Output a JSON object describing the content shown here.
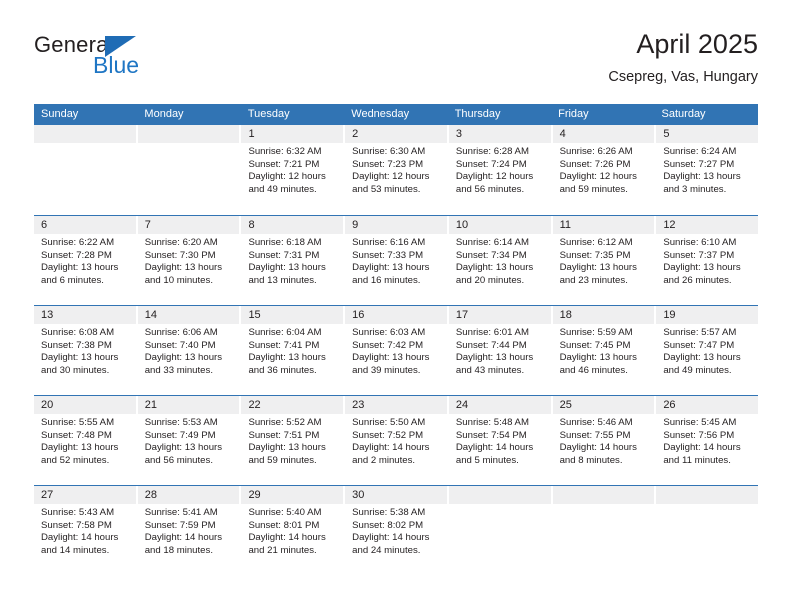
{
  "brand": {
    "name_part1": "General",
    "name_part2": "Blue",
    "accent_color": "#1f76c4",
    "triangle_color": "#1f6cb5"
  },
  "header": {
    "title": "April 2025",
    "subtitle": "Csepreg, Vas, Hungary"
  },
  "calendar": {
    "header_bg": "#3174b4",
    "daynum_bg": "#efeff0",
    "weekdays": [
      "Sunday",
      "Monday",
      "Tuesday",
      "Wednesday",
      "Thursday",
      "Friday",
      "Saturday"
    ],
    "weeks": [
      [
        {
          "day": "",
          "sunrise": "",
          "sunset": "",
          "daylight1": "",
          "daylight2": ""
        },
        {
          "day": "",
          "sunrise": "",
          "sunset": "",
          "daylight1": "",
          "daylight2": ""
        },
        {
          "day": "1",
          "sunrise": "Sunrise: 6:32 AM",
          "sunset": "Sunset: 7:21 PM",
          "daylight1": "Daylight: 12 hours",
          "daylight2": "and 49 minutes."
        },
        {
          "day": "2",
          "sunrise": "Sunrise: 6:30 AM",
          "sunset": "Sunset: 7:23 PM",
          "daylight1": "Daylight: 12 hours",
          "daylight2": "and 53 minutes."
        },
        {
          "day": "3",
          "sunrise": "Sunrise: 6:28 AM",
          "sunset": "Sunset: 7:24 PM",
          "daylight1": "Daylight: 12 hours",
          "daylight2": "and 56 minutes."
        },
        {
          "day": "4",
          "sunrise": "Sunrise: 6:26 AM",
          "sunset": "Sunset: 7:26 PM",
          "daylight1": "Daylight: 12 hours",
          "daylight2": "and 59 minutes."
        },
        {
          "day": "5",
          "sunrise": "Sunrise: 6:24 AM",
          "sunset": "Sunset: 7:27 PM",
          "daylight1": "Daylight: 13 hours",
          "daylight2": "and 3 minutes."
        }
      ],
      [
        {
          "day": "6",
          "sunrise": "Sunrise: 6:22 AM",
          "sunset": "Sunset: 7:28 PM",
          "daylight1": "Daylight: 13 hours",
          "daylight2": "and 6 minutes."
        },
        {
          "day": "7",
          "sunrise": "Sunrise: 6:20 AM",
          "sunset": "Sunset: 7:30 PM",
          "daylight1": "Daylight: 13 hours",
          "daylight2": "and 10 minutes."
        },
        {
          "day": "8",
          "sunrise": "Sunrise: 6:18 AM",
          "sunset": "Sunset: 7:31 PM",
          "daylight1": "Daylight: 13 hours",
          "daylight2": "and 13 minutes."
        },
        {
          "day": "9",
          "sunrise": "Sunrise: 6:16 AM",
          "sunset": "Sunset: 7:33 PM",
          "daylight1": "Daylight: 13 hours",
          "daylight2": "and 16 minutes."
        },
        {
          "day": "10",
          "sunrise": "Sunrise: 6:14 AM",
          "sunset": "Sunset: 7:34 PM",
          "daylight1": "Daylight: 13 hours",
          "daylight2": "and 20 minutes."
        },
        {
          "day": "11",
          "sunrise": "Sunrise: 6:12 AM",
          "sunset": "Sunset: 7:35 PM",
          "daylight1": "Daylight: 13 hours",
          "daylight2": "and 23 minutes."
        },
        {
          "day": "12",
          "sunrise": "Sunrise: 6:10 AM",
          "sunset": "Sunset: 7:37 PM",
          "daylight1": "Daylight: 13 hours",
          "daylight2": "and 26 minutes."
        }
      ],
      [
        {
          "day": "13",
          "sunrise": "Sunrise: 6:08 AM",
          "sunset": "Sunset: 7:38 PM",
          "daylight1": "Daylight: 13 hours",
          "daylight2": "and 30 minutes."
        },
        {
          "day": "14",
          "sunrise": "Sunrise: 6:06 AM",
          "sunset": "Sunset: 7:40 PM",
          "daylight1": "Daylight: 13 hours",
          "daylight2": "and 33 minutes."
        },
        {
          "day": "15",
          "sunrise": "Sunrise: 6:04 AM",
          "sunset": "Sunset: 7:41 PM",
          "daylight1": "Daylight: 13 hours",
          "daylight2": "and 36 minutes."
        },
        {
          "day": "16",
          "sunrise": "Sunrise: 6:03 AM",
          "sunset": "Sunset: 7:42 PM",
          "daylight1": "Daylight: 13 hours",
          "daylight2": "and 39 minutes."
        },
        {
          "day": "17",
          "sunrise": "Sunrise: 6:01 AM",
          "sunset": "Sunset: 7:44 PM",
          "daylight1": "Daylight: 13 hours",
          "daylight2": "and 43 minutes."
        },
        {
          "day": "18",
          "sunrise": "Sunrise: 5:59 AM",
          "sunset": "Sunset: 7:45 PM",
          "daylight1": "Daylight: 13 hours",
          "daylight2": "and 46 minutes."
        },
        {
          "day": "19",
          "sunrise": "Sunrise: 5:57 AM",
          "sunset": "Sunset: 7:47 PM",
          "daylight1": "Daylight: 13 hours",
          "daylight2": "and 49 minutes."
        }
      ],
      [
        {
          "day": "20",
          "sunrise": "Sunrise: 5:55 AM",
          "sunset": "Sunset: 7:48 PM",
          "daylight1": "Daylight: 13 hours",
          "daylight2": "and 52 minutes."
        },
        {
          "day": "21",
          "sunrise": "Sunrise: 5:53 AM",
          "sunset": "Sunset: 7:49 PM",
          "daylight1": "Daylight: 13 hours",
          "daylight2": "and 56 minutes."
        },
        {
          "day": "22",
          "sunrise": "Sunrise: 5:52 AM",
          "sunset": "Sunset: 7:51 PM",
          "daylight1": "Daylight: 13 hours",
          "daylight2": "and 59 minutes."
        },
        {
          "day": "23",
          "sunrise": "Sunrise: 5:50 AM",
          "sunset": "Sunset: 7:52 PM",
          "daylight1": "Daylight: 14 hours",
          "daylight2": "and 2 minutes."
        },
        {
          "day": "24",
          "sunrise": "Sunrise: 5:48 AM",
          "sunset": "Sunset: 7:54 PM",
          "daylight1": "Daylight: 14 hours",
          "daylight2": "and 5 minutes."
        },
        {
          "day": "25",
          "sunrise": "Sunrise: 5:46 AM",
          "sunset": "Sunset: 7:55 PM",
          "daylight1": "Daylight: 14 hours",
          "daylight2": "and 8 minutes."
        },
        {
          "day": "26",
          "sunrise": "Sunrise: 5:45 AM",
          "sunset": "Sunset: 7:56 PM",
          "daylight1": "Daylight: 14 hours",
          "daylight2": "and 11 minutes."
        }
      ],
      [
        {
          "day": "27",
          "sunrise": "Sunrise: 5:43 AM",
          "sunset": "Sunset: 7:58 PM",
          "daylight1": "Daylight: 14 hours",
          "daylight2": "and 14 minutes."
        },
        {
          "day": "28",
          "sunrise": "Sunrise: 5:41 AM",
          "sunset": "Sunset: 7:59 PM",
          "daylight1": "Daylight: 14 hours",
          "daylight2": "and 18 minutes."
        },
        {
          "day": "29",
          "sunrise": "Sunrise: 5:40 AM",
          "sunset": "Sunset: 8:01 PM",
          "daylight1": "Daylight: 14 hours",
          "daylight2": "and 21 minutes."
        },
        {
          "day": "30",
          "sunrise": "Sunrise: 5:38 AM",
          "sunset": "Sunset: 8:02 PM",
          "daylight1": "Daylight: 14 hours",
          "daylight2": "and 24 minutes."
        },
        {
          "day": "",
          "sunrise": "",
          "sunset": "",
          "daylight1": "",
          "daylight2": ""
        },
        {
          "day": "",
          "sunrise": "",
          "sunset": "",
          "daylight1": "",
          "daylight2": ""
        },
        {
          "day": "",
          "sunrise": "",
          "sunset": "",
          "daylight1": "",
          "daylight2": ""
        }
      ]
    ]
  }
}
